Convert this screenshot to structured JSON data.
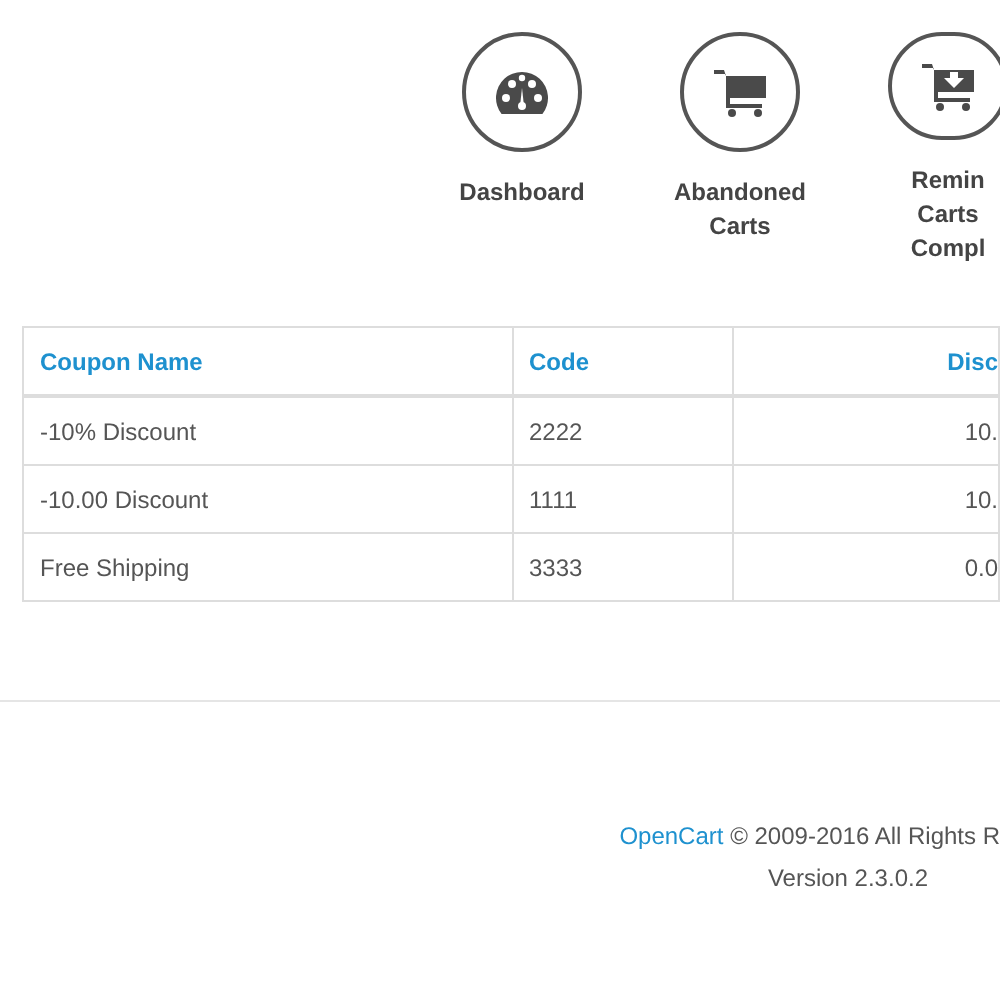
{
  "shortcuts": [
    {
      "kind": "dashboard",
      "lines": [
        "Dashboard"
      ]
    },
    {
      "kind": "cart",
      "lines": [
        "Abandoned",
        "Carts"
      ]
    },
    {
      "kind": "cart-arrow",
      "lines": [
        "Remin",
        "Carts",
        "Compl"
      ]
    }
  ],
  "table": {
    "columns": [
      "Coupon Name",
      "Code",
      "Disc"
    ],
    "rows": [
      [
        "-10% Discount",
        "2222",
        "10."
      ],
      [
        "-10.00 Discount",
        "1111",
        "10."
      ],
      [
        "Free Shipping",
        "3333",
        "0.0"
      ]
    ]
  },
  "footer": {
    "link": "OpenCart",
    "text": "© 2009-2016 All Rights R",
    "version": "Version 2.3.0.2"
  }
}
